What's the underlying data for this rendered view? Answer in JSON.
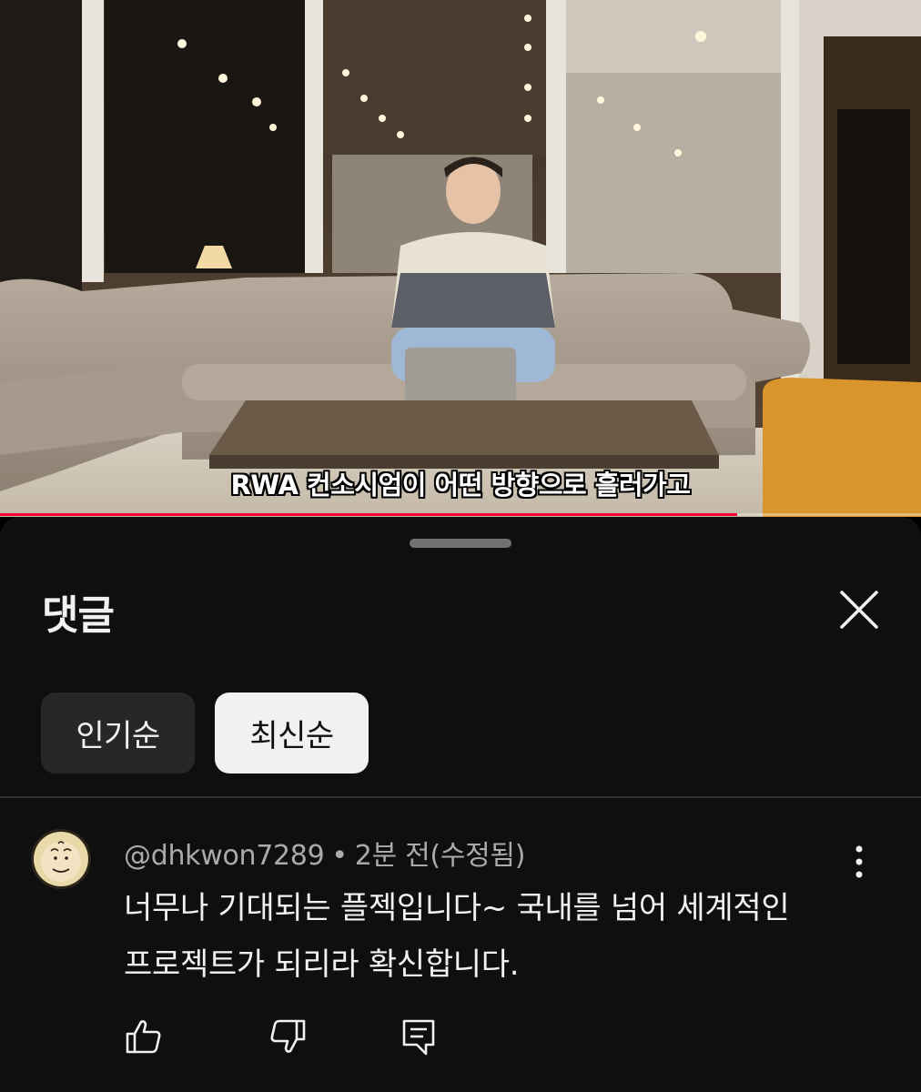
{
  "video": {
    "subtitle": "RWA 컨소시엄이 어떤 방향으로 흘러가고",
    "progress_fraction": 0.8
  },
  "sheet": {
    "title": "댓글",
    "close_icon": "close-icon",
    "sort_chips": [
      {
        "label": "인기순",
        "selected": false
      },
      {
        "label": "최신순",
        "selected": true
      }
    ]
  },
  "comments": [
    {
      "author": "@dhkwon7289",
      "separator": "•",
      "time": "2분 전(수정됨)",
      "text_line1": "너무나 기대되는 플젝입니다~ 국내를 넘어 세계적인",
      "text_line2": "프로젝트가 되리라 확신합니다.",
      "icons": [
        "like-icon",
        "dislike-icon",
        "reply-icon",
        "more-vert-icon"
      ]
    }
  ],
  "colors": {
    "background": "#0f0f0f",
    "chip_inactive": "#272727",
    "chip_active": "#f1f1f1",
    "text_primary": "#f1f1f1",
    "text_secondary": "#aaaaaa",
    "progress": "#ff0033"
  }
}
